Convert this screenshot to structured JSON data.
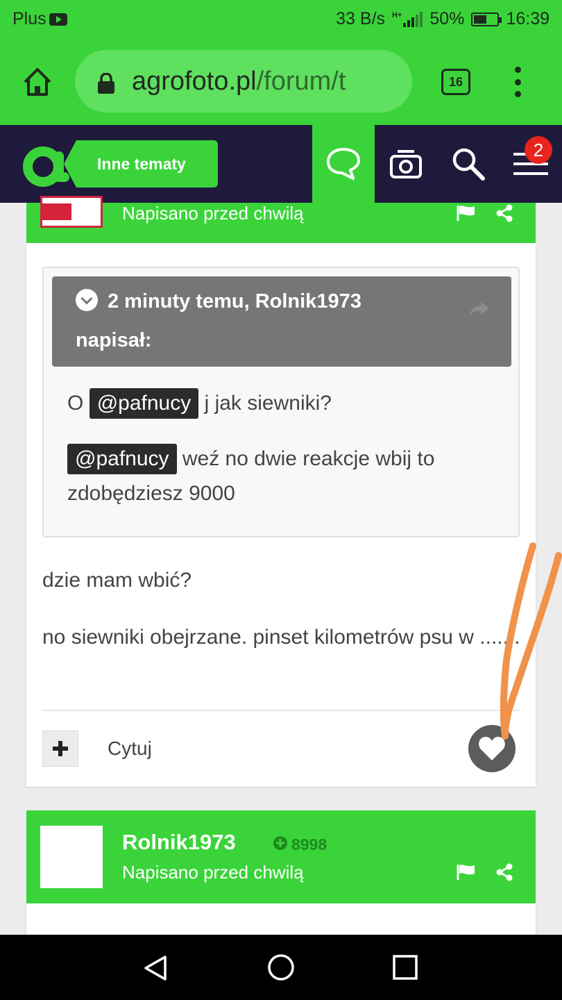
{
  "status_bar": {
    "carrier": "Plus",
    "speed": "33 B/s",
    "network_type": "H+",
    "battery": "50%",
    "time": "16:39"
  },
  "browser": {
    "url_main": "agrofoto.pl",
    "url_rest": "/forum/t",
    "tab_count": "16"
  },
  "site_nav": {
    "section_label": "Inne tematy",
    "notification_count": "2"
  },
  "post1": {
    "timestamp": "Napisano przed chwilą",
    "quote_header_line1": "2 minuty temu, Rolnik1973",
    "quote_header_line2": "napisał:",
    "quote_line1_prefix": "O",
    "quote_line1_mention": "@pafnucy",
    "quote_line1_suffix": "j jak siewniki?",
    "quote_line2_mention": "@pafnucy",
    "quote_line2_suffix": "weź no dwie reakcje wbij to zdobędziesz 9000",
    "text_line1": "dzie mam wbić?",
    "text_line2": "no siewniki obejrzane. pinset kilometrów psu w ..... .",
    "quote_button": "Cytuj"
  },
  "post2": {
    "author": "Rolnik1973",
    "reputation": "8998",
    "timestamp": "Napisano przed chwilą"
  },
  "colors": {
    "accent_green": "#3ad43a",
    "nav_dark": "#1e1a3c",
    "annotation_orange": "#f0924a"
  }
}
